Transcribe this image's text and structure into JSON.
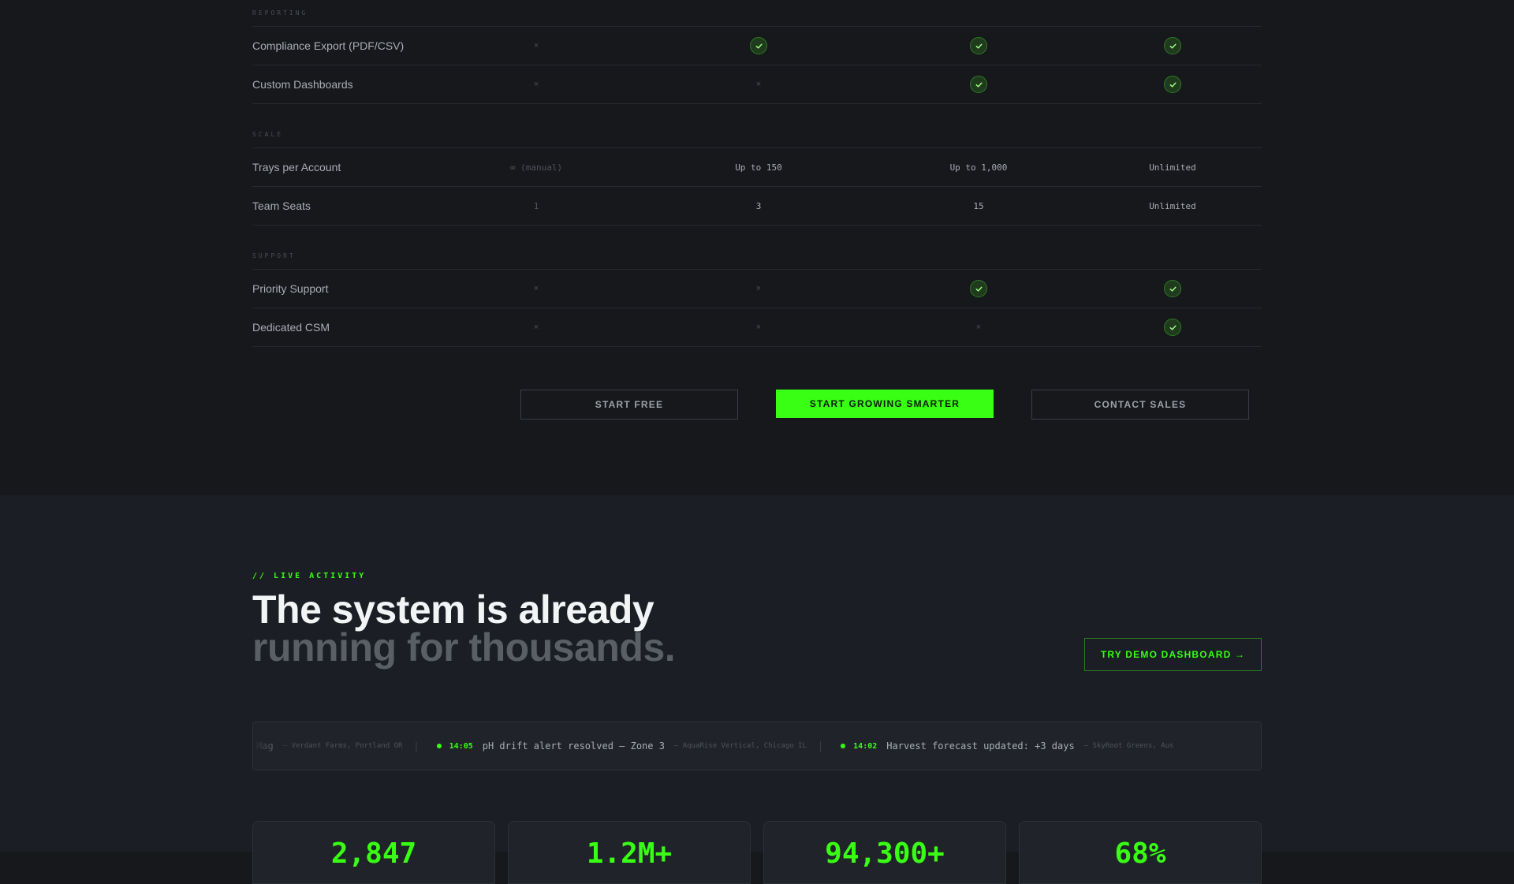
{
  "comparison": {
    "sections": [
      {
        "heading": "REPORTING",
        "rows": [
          {
            "feature": "Compliance Export (PDF/CSV)",
            "cells": [
              "x",
              "check",
              "check",
              "check"
            ]
          },
          {
            "feature": "Custom Dashboards",
            "cells": [
              "x",
              "x",
              "check",
              "check"
            ]
          }
        ]
      },
      {
        "heading": "SCALE",
        "rows": [
          {
            "feature": "Trays per Account",
            "cells": [
              "∞ (manual)",
              "Up to 150",
              "Up to 1,000",
              "Unlimited"
            ]
          },
          {
            "feature": "Team Seats",
            "cells": [
              "1",
              "3",
              "15",
              "Unlimited"
            ]
          }
        ]
      },
      {
        "heading": "SUPPORT",
        "rows": [
          {
            "feature": "Priority Support",
            "cells": [
              "x",
              "x",
              "check",
              "check"
            ]
          },
          {
            "feature": "Dedicated CSM",
            "cells": [
              "x",
              "x",
              "x",
              "check"
            ]
          }
        ]
      }
    ],
    "cross_glyph": "×",
    "cta": {
      "start_free": "START FREE",
      "start_growing": "START GROWING SMARTER",
      "contact_sales": "CONTACT SALES"
    }
  },
  "live": {
    "eyebrow": "// LIVE ACTIVITY",
    "headline_line1": "The system is already",
    "headline_line2": "running for thousands.",
    "demo_button": "TRY DEMO DASHBOARD →",
    "ticker": [
      {
        "time": "",
        "message": "Mag",
        "source": "— Verdant Farms, Portland OR"
      },
      {
        "time": "14:05",
        "message": "pH drift alert resolved — Zone 3",
        "source": "— AquaRise Vertical, Chicago IL"
      },
      {
        "time": "14:02",
        "message": "Harvest forecast updated: +3 days",
        "source": "— SkyRoot Greens, Aus"
      }
    ],
    "ticker_separator": "|",
    "stats": [
      "2,847",
      "1.2M+",
      "94,300+",
      "68%"
    ]
  },
  "colors": {
    "accent": "#39ff14",
    "background": "#16181c",
    "section_bg": "#1b1e24"
  }
}
